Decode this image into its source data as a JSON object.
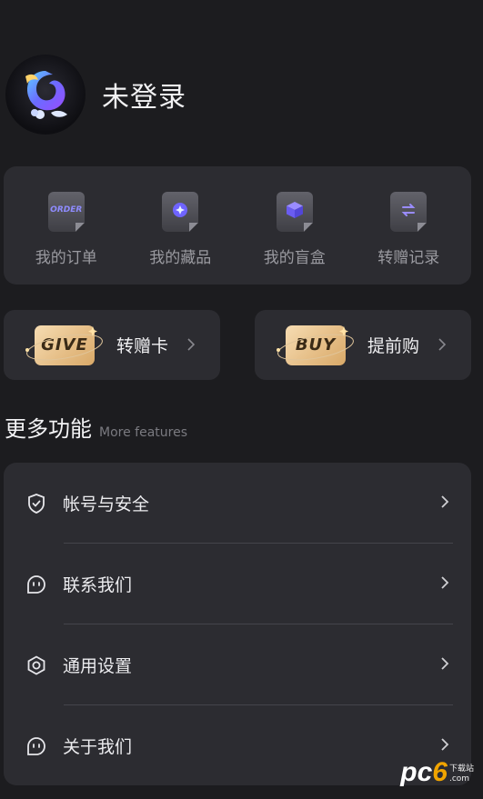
{
  "profile": {
    "username": "未登录"
  },
  "quick_actions": [
    {
      "label": "我的订单",
      "icon": "order-icon",
      "tile_text": "ORDER"
    },
    {
      "label": "我的藏品",
      "icon": "collection-icon"
    },
    {
      "label": "我的盲盒",
      "icon": "blind-box-icon"
    },
    {
      "label": "转赠记录",
      "icon": "transfer-record-icon"
    }
  ],
  "promos": {
    "give": {
      "badge": "GIVE",
      "label": "转赠卡"
    },
    "buy": {
      "badge": "BUY",
      "label": "提前购"
    }
  },
  "more_features": {
    "title": "更多功能",
    "subtitle": "More features",
    "items": [
      {
        "label": "帐号与安全",
        "icon": "shield-check-icon"
      },
      {
        "label": "联系我们",
        "icon": "contact-icon"
      },
      {
        "label": "通用设置",
        "icon": "settings-hexagon-icon"
      },
      {
        "label": "关于我们",
        "icon": "about-icon"
      }
    ]
  },
  "watermark": {
    "pc": "pc",
    "six": "6",
    "top": "下载站",
    "bottom": ".com"
  },
  "colors": {
    "background": "#1c1c1f",
    "card": "#2c2c31",
    "gold": "#e6bf88",
    "accent_purple": "#8a6cff"
  }
}
